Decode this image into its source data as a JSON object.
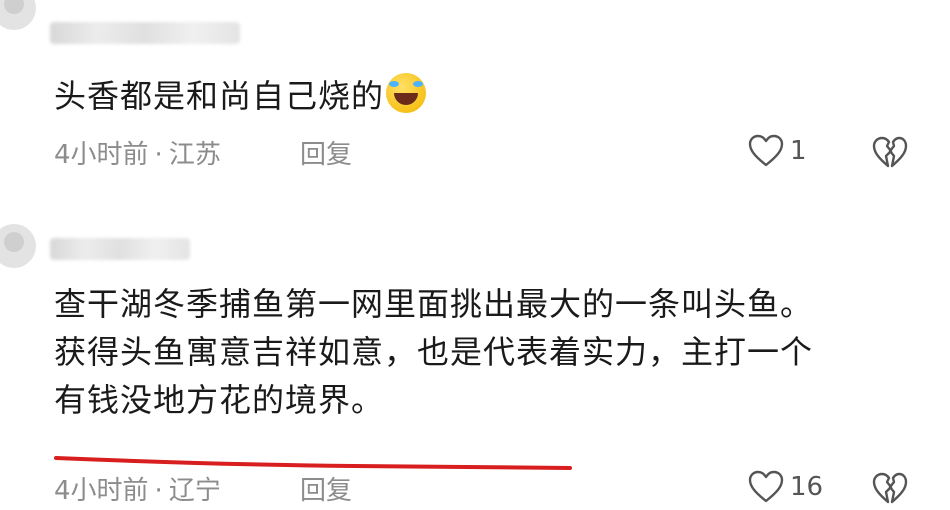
{
  "comments": [
    {
      "text_lines": [
        "头香都是和尚自己烧的"
      ],
      "emoji": "laughing-crying-emoji",
      "time": "4小时前",
      "separator": "·",
      "location": "江苏",
      "reply_label": "回复",
      "like_count": "1"
    },
    {
      "text_lines": [
        "查干湖冬季捕鱼第一网里面挑出最大的一条叫头鱼。",
        "获得头鱼寓意吉祥如意，也是代表着实力，主打一个",
        "有钱没地方花的境界。"
      ],
      "time": "4小时前",
      "separator": "·",
      "location": "辽宁",
      "reply_label": "回复",
      "like_count": "16"
    }
  ],
  "icons": {
    "like": "heart-outline-icon",
    "dislike": "broken-heart-icon"
  },
  "colors": {
    "text": "#1a1a1a",
    "meta": "#8c8c8c",
    "highlight_underline": "#d81e1e"
  }
}
